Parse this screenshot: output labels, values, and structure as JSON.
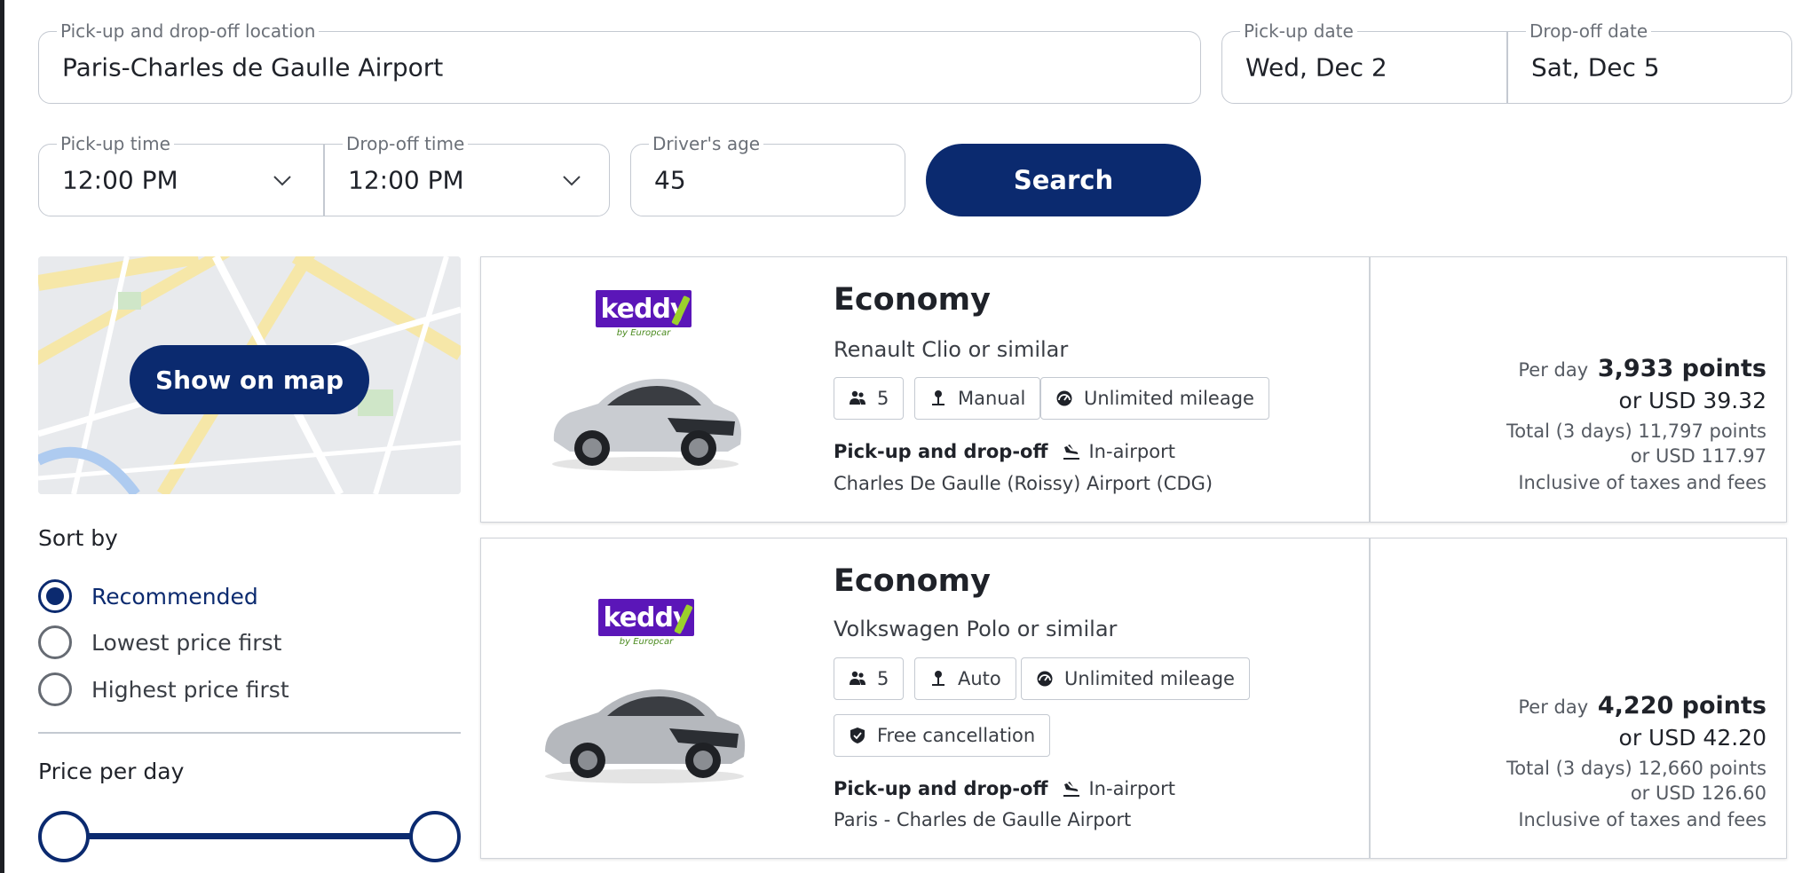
{
  "search": {
    "location_label": "Pick-up and drop-off location",
    "location_value": "Paris-Charles de Gaulle Airport",
    "pickup_date_label": "Pick-up date",
    "pickup_date_value": "Wed, Dec 2",
    "dropoff_date_label": "Drop-off date",
    "dropoff_date_value": "Sat, Dec 5",
    "pickup_time_label": "Pick-up time",
    "pickup_time_value": "12:00 PM",
    "dropoff_time_label": "Drop-off time",
    "dropoff_time_value": "12:00 PM",
    "age_label": "Driver's age",
    "age_value": "45",
    "search_button": "Search"
  },
  "sidebar": {
    "map_button": "Show on map",
    "sort_heading": "Sort by",
    "sort_options": [
      {
        "label": "Recommended",
        "checked": true
      },
      {
        "label": "Lowest price first",
        "checked": false
      },
      {
        "label": "Highest price first",
        "checked": false
      }
    ],
    "price_heading": "Price per day",
    "price_slider": {
      "min_fraction": 0.0,
      "max_fraction": 1.0
    }
  },
  "results": [
    {
      "logo_text": "keddy",
      "logo_sub": "by Europcar",
      "car_class": "Economy",
      "car_model": "Renault Clio or similar",
      "features": [
        {
          "icon": "passengers-icon",
          "label": "5"
        },
        {
          "icon": "gearshift-icon",
          "label": "Manual"
        },
        {
          "icon": "speedometer-icon",
          "label": "Unlimited mileage"
        }
      ],
      "pickup_label": "Pick-up and drop-off",
      "pickup_type": "In-airport",
      "pickup_location": "Charles De Gaulle (Roissy) Airport (CDG)",
      "per_day_label": "Per day",
      "per_day_points": "3,933 points",
      "per_day_usd": "or USD 39.32",
      "total_points": "Total (3 days) 11,797 points",
      "total_usd": "or USD 117.97",
      "inclusive": "Inclusive of taxes and fees",
      "car_color": "#c9ccd1"
    },
    {
      "logo_text": "keddy",
      "logo_sub": "by Europcar",
      "car_class": "Economy",
      "car_model": "Volkswagen Polo or similar",
      "features": [
        {
          "icon": "passengers-icon",
          "label": "5"
        },
        {
          "icon": "gearshift-icon",
          "label": "Auto"
        },
        {
          "icon": "speedometer-icon",
          "label": "Unlimited mileage"
        },
        {
          "icon": "shield-icon",
          "label": "Free cancellation"
        }
      ],
      "pickup_label": "Pick-up and drop-off",
      "pickup_type": "In-airport",
      "pickup_location": "Paris - Charles de Gaulle Airport",
      "per_day_label": "Per day",
      "per_day_points": "4,220 points",
      "per_day_usd": "or USD 42.20",
      "total_points": "Total (3 days) 12,660 points",
      "total_usd": "or USD 126.60",
      "inclusive": "Inclusive of taxes and fees",
      "car_color": "#b5b8bd"
    }
  ],
  "colors": {
    "brand_navy": "#0b2a6f",
    "keddy_purple": "#5b16b8",
    "border": "#c4c9d1"
  }
}
